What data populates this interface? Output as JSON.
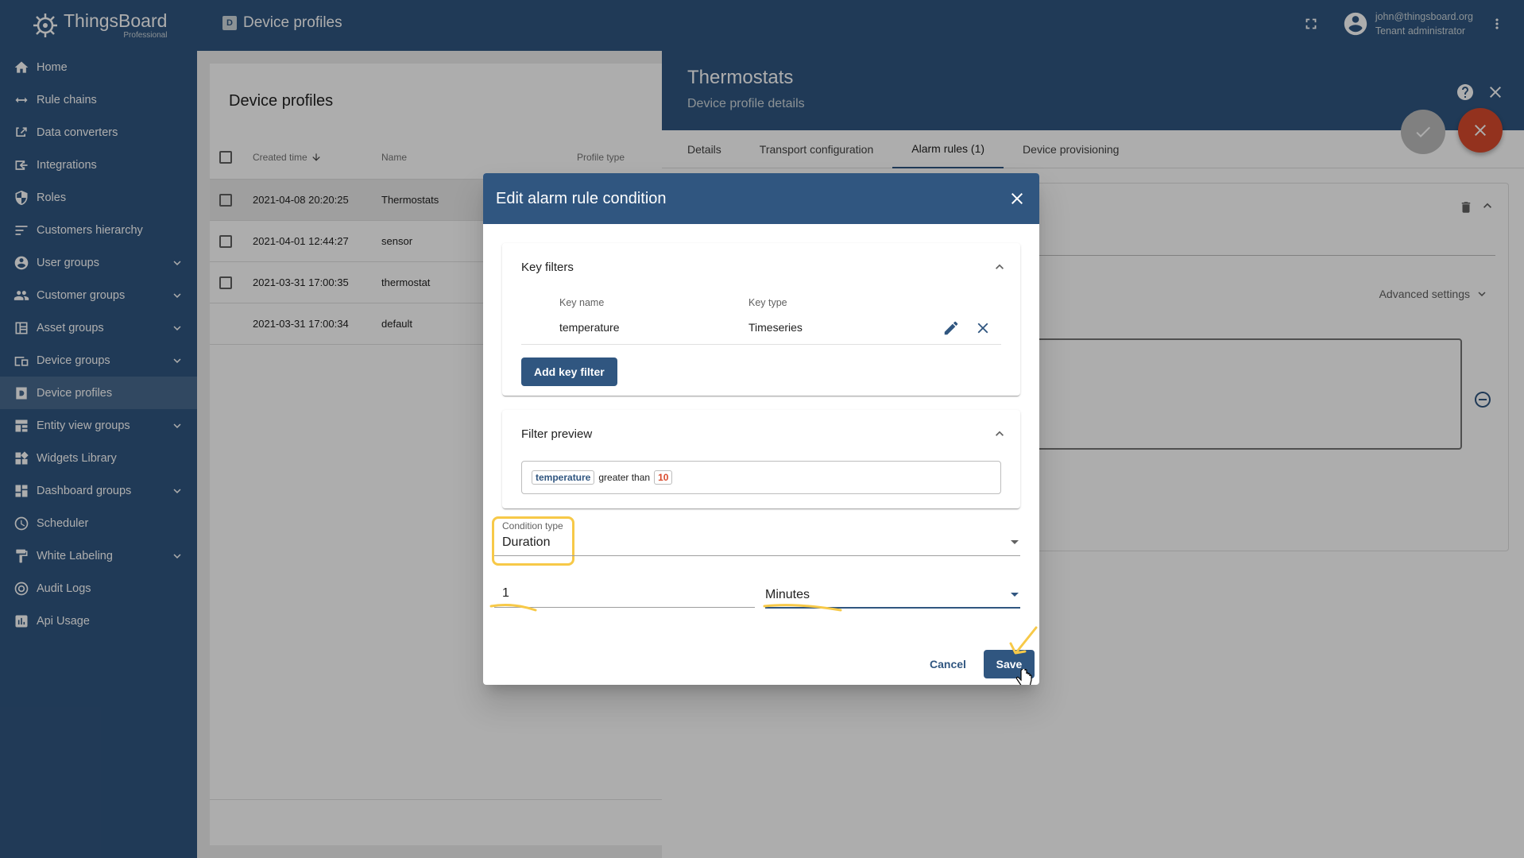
{
  "brand": {
    "name": "ThingsBoard",
    "edition": "Professional"
  },
  "topbar": {
    "title_badge": "D",
    "title": "Device profiles",
    "user_email": "john@thingsboard.org",
    "user_role": "Tenant administrator"
  },
  "sidebar": {
    "items": [
      {
        "label": "Home",
        "icon": "home-icon"
      },
      {
        "label": "Rule chains",
        "icon": "rule-chains-icon"
      },
      {
        "label": "Data converters",
        "icon": "data-converters-icon"
      },
      {
        "label": "Integrations",
        "icon": "integrations-icon"
      },
      {
        "label": "Roles",
        "icon": "roles-icon"
      },
      {
        "label": "Customers hierarchy",
        "icon": "customers-hierarchy-icon"
      },
      {
        "label": "User groups",
        "icon": "user-groups-icon",
        "expandable": true
      },
      {
        "label": "Customer groups",
        "icon": "customer-groups-icon",
        "expandable": true
      },
      {
        "label": "Asset groups",
        "icon": "asset-groups-icon",
        "expandable": true
      },
      {
        "label": "Device groups",
        "icon": "device-groups-icon",
        "expandable": true
      },
      {
        "label": "Device profiles",
        "icon": "device-profiles-icon",
        "active": true
      },
      {
        "label": "Entity view groups",
        "icon": "entity-view-groups-icon",
        "expandable": true
      },
      {
        "label": "Widgets Library",
        "icon": "widgets-library-icon"
      },
      {
        "label": "Dashboard groups",
        "icon": "dashboard-groups-icon",
        "expandable": true
      },
      {
        "label": "Scheduler",
        "icon": "scheduler-icon"
      },
      {
        "label": "White Labeling",
        "icon": "white-labeling-icon",
        "expandable": true
      },
      {
        "label": "Audit Logs",
        "icon": "audit-logs-icon"
      },
      {
        "label": "Api Usage",
        "icon": "api-usage-icon"
      }
    ]
  },
  "profiles_list": {
    "title": "Device profiles",
    "columns": [
      "Created time",
      "Name",
      "Profile type"
    ],
    "rows": [
      {
        "created": "2021-04-08 20:20:25",
        "name": "Thermostats",
        "selected": true
      },
      {
        "created": "2021-04-01 12:44:27",
        "name": "sensor"
      },
      {
        "created": "2021-03-31 17:00:35",
        "name": "thermostat"
      },
      {
        "created": "2021-03-31 17:00:34",
        "name": "default"
      }
    ]
  },
  "details": {
    "title": "Thermostats",
    "subtitle": "Device profile details",
    "tabs": [
      "Details",
      "Transport configuration",
      "Alarm rules (1)",
      "Device provisioning"
    ],
    "active_tab": "Alarm rules (1)",
    "advanced_settings": "Advanced settings"
  },
  "dialog": {
    "title": "Edit alarm rule condition",
    "key_filters": {
      "title": "Key filters",
      "columns": [
        "Key name",
        "Key type"
      ],
      "rows": [
        {
          "key_name": "temperature",
          "key_type": "Timeseries"
        }
      ],
      "add_button": "Add key filter"
    },
    "filter_preview": {
      "title": "Filter preview",
      "key": "temperature",
      "operation": "greater than",
      "value": "10"
    },
    "condition_type": {
      "label": "Condition type",
      "value": "Duration"
    },
    "duration": {
      "value": "1",
      "unit": "Minutes"
    },
    "cancel_button": "Cancel",
    "save_button": "Save"
  },
  "colors": {
    "primary": "#305680",
    "accent": "#d94a2d",
    "highlight": "#f7c948"
  }
}
